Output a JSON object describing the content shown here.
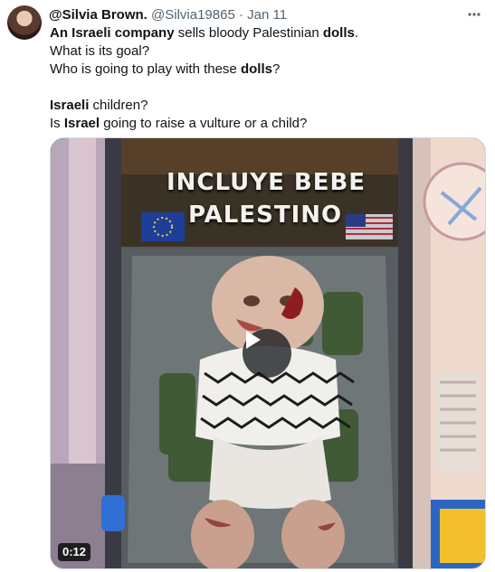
{
  "tweet": {
    "author": {
      "display_name": "@Silvia Brown.",
      "handle": "@Silvia19865",
      "separator": "·",
      "date": "Jan 11"
    },
    "more_icon": "ellipsis-icon",
    "text": {
      "line1_a": "An Israeli company",
      "line1_b": " sells bloody Palestinian ",
      "line1_c": "dolls",
      "line1_d": ".",
      "line2": "What is its goal?",
      "line3_a": "Who is going to play with these ",
      "line3_b": "dolls",
      "line3_c": "?",
      "line4_a": "Israeli",
      "line4_b": " children?",
      "line5_a": "Is ",
      "line5_b": "Israel",
      "line5_c": " going to raise a vulture or a child?"
    },
    "media": {
      "banner_line1": "INCLUYE BEBE",
      "banner_line2": "PALESTINO",
      "play_icon": "play-icon",
      "duration": "0:12"
    }
  }
}
